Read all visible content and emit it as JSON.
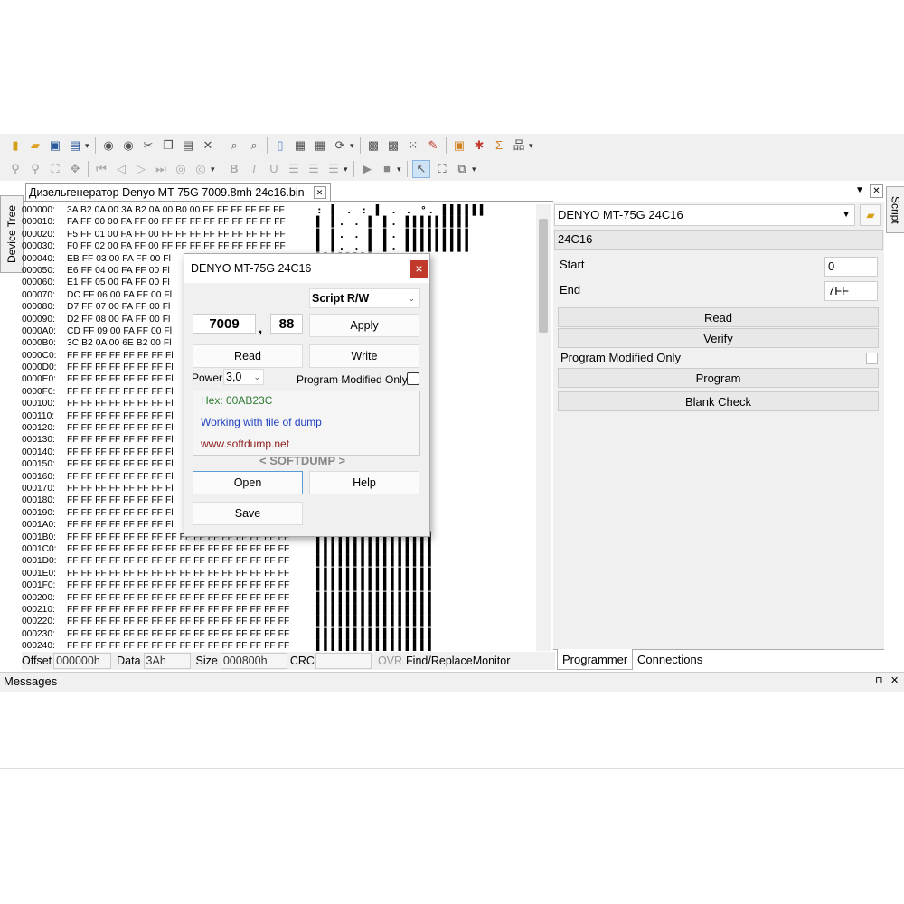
{
  "toolbar1": {
    "icons": [
      "new-icon",
      "open-folder-icon",
      "save-icon",
      "save-as-icon",
      "undo-icon",
      "redo-icon",
      "cut-icon",
      "copy-icon",
      "paste-icon",
      "delete-icon",
      "find-icon",
      "replace-icon",
      "document-icon",
      "fill-icon",
      "insert-icon",
      "sync-icon",
      "chip-icon",
      "chip-write-icon",
      "grid-icon",
      "edit-icon",
      "calculator-icon",
      "bug-icon",
      "sigma-icon",
      "tree-icon"
    ]
  },
  "toolbar2": {
    "icons": [
      "pin-icon",
      "zoom-icon",
      "select-box-icon",
      "move-icon",
      "first-icon",
      "prev-icon",
      "next-icon",
      "last-icon",
      "nav-icon",
      "nav2-icon",
      "bold-icon",
      "italic-icon",
      "underline-icon",
      "align-left-icon",
      "align-center-icon",
      "align-right-icon",
      "play-icon",
      "stop-icon",
      "cursor-icon",
      "zoom-select-icon",
      "resize-icon"
    ]
  },
  "document_tab": {
    "title": "Дизельгенератор Denyo MT-75G 7009.8mh 24c16.bin",
    "close": "✕"
  },
  "side_tabs": {
    "left": "Device Tree",
    "right": "Script"
  },
  "hex": {
    "rows": [
      {
        "off": "000000:",
        "data": "3A B2 0A 00 3A B2 0A 00 B0 00 FF FF FF FF FF FF",
        "ascii": ": ▌ . : ▌ . . °. ▌▌▌▌▌▌"
      },
      {
        "off": "000010:",
        "data": "FA FF 00 00 FA FF 00 FF FF FF FF FF FF FF FF FF",
        "ascii": "▌ ▌. . ▌ ▌. ▌▌▌▌▌▌▌▌▌"
      },
      {
        "off": "000020:",
        "data": "F5 FF 01 00 FA FF 00 FF FF FF FF FF FF FF FF FF",
        "ascii": "▌ ▌. . ▌ ▌. ▌▌▌▌▌▌▌▌▌"
      },
      {
        "off": "000030:",
        "data": "F0 FF 02 00 FA FF 00 FF FF FF FF FF FF FF FF FF",
        "ascii": "▌ ▌. . ▌ ▌. ▌▌▌▌▌▌▌▌▌"
      },
      {
        "off": "000040:",
        "data": "EB FF 03 00 FA FF 00 Fl",
        "ascii": "▌▌▌▌▌▌▌▌"
      },
      {
        "off": "000050:",
        "data": "E6 FF 04 00 FA FF 00 Fl",
        "ascii": "▌▌▌▌▌▌▌▌"
      },
      {
        "off": "000060:",
        "data": "E1 FF 05 00 FA FF 00 Fl",
        "ascii": "▌▌▌▌▌▌▌▌"
      },
      {
        "off": "000070:",
        "data": "DC FF 06 00 FA FF 00 Fl",
        "ascii": "▌▌▌▌▌▌▌▌"
      },
      {
        "off": "000080:",
        "data": "D7 FF 07 00 FA FF 00 Fl",
        "ascii": "▌▌▌▌▌▌▌▌"
      },
      {
        "off": "000090:",
        "data": "D2 FF 08 00 FA FF 00 Fl",
        "ascii": "▌▌▌▌▌▌▌▌"
      },
      {
        "off": "0000A0:",
        "data": "CD FF 09 00 FA FF 00 Fl",
        "ascii": "▌▌▌▌▌▌▌▌"
      },
      {
        "off": "0000B0:",
        "data": "3C B2 0A 00 6E B2 00 Fl",
        "ascii": "▌▌▌▌▌▌▌▌"
      },
      {
        "off": "0000C0:",
        "data": "FF FF FF FF FF FF FF Fl",
        "ascii": "▌▌▌▌▌▌▌▌"
      },
      {
        "off": "0000D0:",
        "data": "FF FF FF FF FF FF FF Fl",
        "ascii": "▌▌▌▌▌▌▌▌"
      },
      {
        "off": "0000E0:",
        "data": "FF FF FF FF FF FF FF Fl",
        "ascii": "▌▌▌▌▌▌▌▌"
      },
      {
        "off": "0000F0:",
        "data": "FF FF FF FF FF FF FF Fl",
        "ascii": "▌▌▌▌▌▌▌▌"
      },
      {
        "off": "000100:",
        "data": "FF FF FF FF FF FF FF Fl",
        "ascii": "▌▌▌▌▌▌▌▌"
      },
      {
        "off": "000110:",
        "data": "FF FF FF FF FF FF FF Fl",
        "ascii": "▌▌▌▌▌▌▌▌"
      },
      {
        "off": "000120:",
        "data": "FF FF FF FF FF FF FF Fl",
        "ascii": "▌▌▌▌▌▌▌▌"
      },
      {
        "off": "000130:",
        "data": "FF FF FF FF FF FF FF Fl",
        "ascii": "▌▌▌▌▌▌▌▌"
      },
      {
        "off": "000140:",
        "data": "FF FF FF FF FF FF FF Fl",
        "ascii": "▌▌▌▌▌▌▌▌"
      },
      {
        "off": "000150:",
        "data": "FF FF FF FF FF FF FF Fl",
        "ascii": "▌▌▌▌▌▌▌▌"
      },
      {
        "off": "000160:",
        "data": "FF FF FF FF FF FF FF Fl",
        "ascii": "▌▌▌▌▌▌▌▌"
      },
      {
        "off": "000170:",
        "data": "FF FF FF FF FF FF FF Fl",
        "ascii": "▌▌▌▌▌▌▌▌"
      },
      {
        "off": "000180:",
        "data": "FF FF FF FF FF FF FF Fl",
        "ascii": "▌▌▌▌▌▌▌▌"
      },
      {
        "off": "000190:",
        "data": "FF FF FF FF FF FF FF Fl",
        "ascii": "▌▌▌▌▌▌▌▌"
      },
      {
        "off": "0001A0:",
        "data": "FF FF FF FF FF FF FF Fl",
        "ascii": "▌▌▌▌▌▌▌▌"
      },
      {
        "off": "0001B0:",
        "data": "FF FF FF FF FF FF FF FF FF FF FF FF FF FF FF FF",
        "ascii": "▌▌▌▌▌▌▌▌▌▌▌▌▌▌▌▌"
      },
      {
        "off": "0001C0:",
        "data": "FF FF FF FF FF FF FF FF FF FF FF FF FF FF FF FF",
        "ascii": "▌▌▌▌▌▌▌▌▌▌▌▌▌▌▌▌"
      },
      {
        "off": "0001D0:",
        "data": "FF FF FF FF FF FF FF FF FF FF FF FF FF FF FF FF",
        "ascii": "▌▌▌▌▌▌▌▌▌▌▌▌▌▌▌▌"
      },
      {
        "off": "0001E0:",
        "data": "FF FF FF FF FF FF FF FF FF FF FF FF FF FF FF FF",
        "ascii": "▌▌▌▌▌▌▌▌▌▌▌▌▌▌▌▌"
      },
      {
        "off": "0001F0:",
        "data": "FF FF FF FF FF FF FF FF FF FF FF FF FF FF FF FF",
        "ascii": "▌▌▌▌▌▌▌▌▌▌▌▌▌▌▌▌"
      },
      {
        "off": "000200:",
        "data": "FF FF FF FF FF FF FF FF FF FF FF FF FF FF FF FF",
        "ascii": "▌▌▌▌▌▌▌▌▌▌▌▌▌▌▌▌"
      },
      {
        "off": "000210:",
        "data": "FF FF FF FF FF FF FF FF FF FF FF FF FF FF FF FF",
        "ascii": "▌▌▌▌▌▌▌▌▌▌▌▌▌▌▌▌"
      },
      {
        "off": "000220:",
        "data": "FF FF FF FF FF FF FF FF FF FF FF FF FF FF FF FF",
        "ascii": "▌▌▌▌▌▌▌▌▌▌▌▌▌▌▌▌"
      },
      {
        "off": "000230:",
        "data": "FF FF FF FF FF FF FF FF FF FF FF FF FF FF FF FF",
        "ascii": "▌▌▌▌▌▌▌▌▌▌▌▌▌▌▌▌"
      },
      {
        "off": "000240:",
        "data": "FF FF FF FF FF FF FF FF FF FF FF FF FF FF FF FF",
        "ascii": "▌▌▌▌▌▌▌▌▌▌▌▌▌▌▌▌"
      }
    ]
  },
  "status": {
    "offset_label": "Offset",
    "offset_value": "000000h",
    "data_label": "Data",
    "data_value": "3Ah",
    "size_label": "Size",
    "size_value": "000800h",
    "crc_label": "CRC",
    "crc_value": "",
    "ovr": "OVR",
    "find_replace": "Find/Replace",
    "monitor": "Monitor"
  },
  "dialog": {
    "title": "DENYO MT-75G 24C16",
    "close": "×",
    "script_select": "Script R/W",
    "value1": "7009",
    "separator": ",",
    "value2": "88",
    "apply": "Apply",
    "read": "Read",
    "write": "Write",
    "power_label": "Power",
    "power_value": "3,0",
    "program_modified_label": "Program Modified Only",
    "hex_info": "Hex: 00AB23C",
    "working_info": "Working with file of dump",
    "url": "www.softdump.net",
    "brand": "< SOFTDUMP >",
    "open": "Open",
    "help": "Help",
    "save": "Save"
  },
  "programmer": {
    "device": "DENYO MT-75G 24C16",
    "chip": "24C16",
    "start_label": "Start",
    "start_value": "0",
    "end_label": "End",
    "end_value": "7FF",
    "read": "Read",
    "verify": "Verify",
    "program_modified_label": "Program Modified Only",
    "program": "Program",
    "blank_check": "Blank Check",
    "tabs": [
      "Programmer",
      "Connections"
    ]
  },
  "messages": {
    "title": "Messages",
    "pin": "⊓",
    "close": "✕"
  },
  "colors": {
    "accent_green": "#2e7d32",
    "accent_blue": "#1f3fbf",
    "accent_red": "#8b1a1a",
    "close_red": "#c0392b"
  }
}
